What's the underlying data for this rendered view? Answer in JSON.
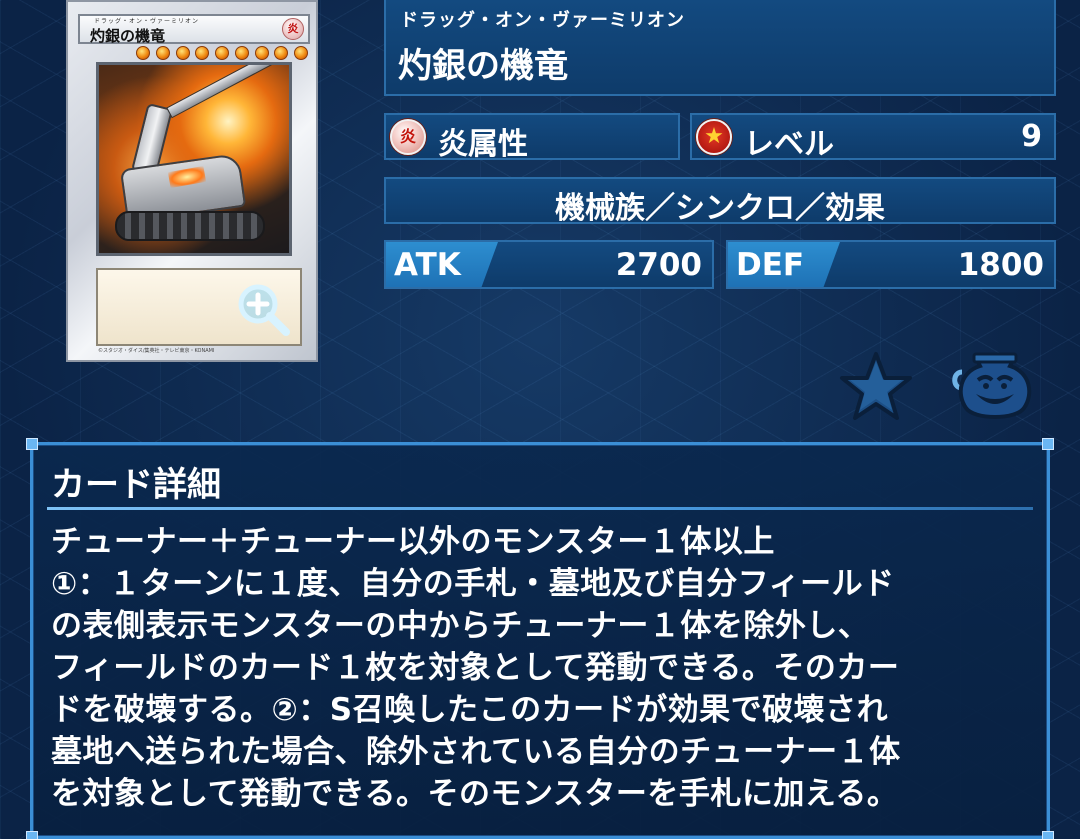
{
  "card": {
    "ruby": "ドラッグ・オン・ヴァーミリオン",
    "name": "灼銀の機竜",
    "attribute_glyph": "炎",
    "level_stars": 9,
    "footer": "©スタジオ・ダイス/集英社・テレビ東京・KONAMI"
  },
  "header": {
    "ruby": "ドラッグ・オン・ヴァーミリオン",
    "title": "灼銀の機竜"
  },
  "attribute": {
    "icon_glyph": "炎",
    "label": "炎属性"
  },
  "level": {
    "icon_glyph": "★",
    "label": "レベル",
    "value": "9"
  },
  "type_line": "機械族／シンクロ／効果",
  "stats": {
    "atk_label": "ATK",
    "atk_value": "2700",
    "def_label": "DEF",
    "def_value": "1800"
  },
  "actions": {
    "favorite_icon": "star-icon",
    "deck_icon": "pot-of-greed-icon"
  },
  "detail": {
    "title": "カード詳細",
    "text": "チューナー＋チューナー以外のモンスター１体以上\n①：１ターンに１度、自分の手札・墓地及び自分フィールド\nの表側表示モンスターの中からチューナー１体を除外し、\nフィールドのカード１枚を対象として発動できる。そのカー\nドを破壊する。②：S召喚したこのカードが効果で破壊され\n墓地へ送られた場合、除外されている自分のチューナー１体\nを対象として発動できる。そのモンスターを手札に加える。"
  },
  "colors": {
    "background": "#0b2346",
    "panel": "#134a80",
    "panel_border": "#2b6da8",
    "stat_tag": "#2d8ed0",
    "detail_border": "#3b8fd6"
  }
}
